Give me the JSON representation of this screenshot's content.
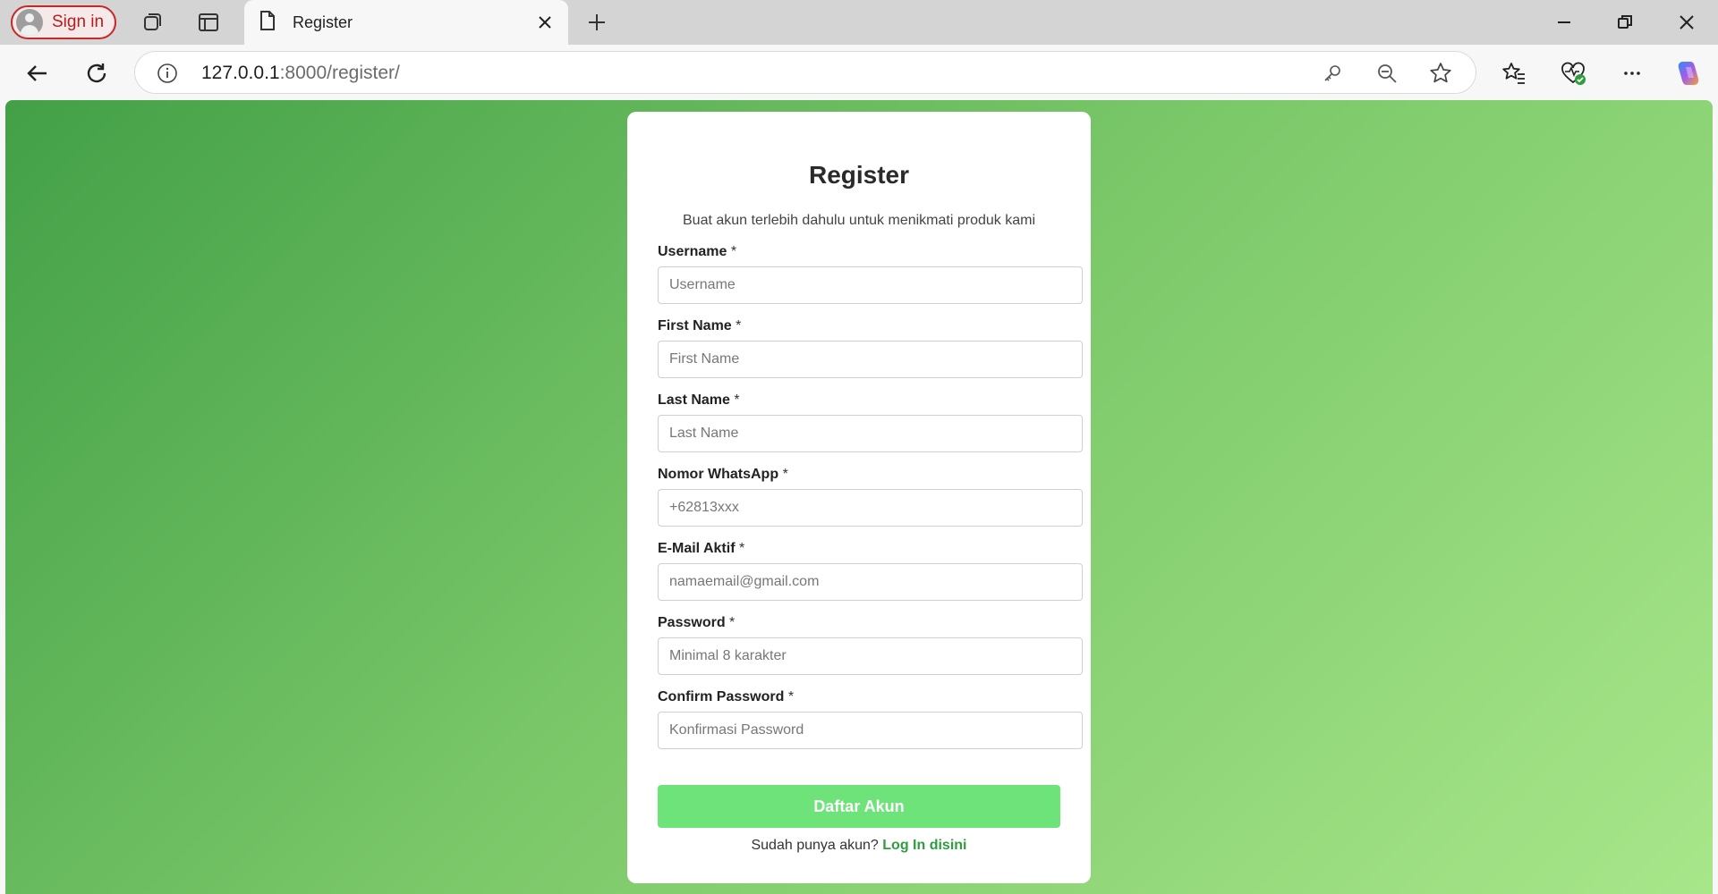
{
  "browser": {
    "signin_label": "Sign in",
    "tab_title": "Register",
    "url_host": "127.0.0.1",
    "url_path": ":8000/register/"
  },
  "icons": [
    "profile-avatar-icon",
    "workspaces-icon",
    "tab-actions-icon",
    "page-icon",
    "close-icon",
    "plus-icon",
    "minimize-icon",
    "restore-icon",
    "window-close-icon",
    "back-icon",
    "refresh-icon",
    "info-icon",
    "key-icon",
    "zoom-out-icon",
    "star-icon",
    "favorites-icon",
    "health-icon",
    "more-icon",
    "copilot-icon"
  ],
  "form": {
    "title": "Register",
    "subtitle": "Buat akun terlebih dahulu untuk menikmati produk kami",
    "required_mark": "*",
    "fields": [
      {
        "label": "Username",
        "placeholder": "Username",
        "value": ""
      },
      {
        "label": "First Name",
        "placeholder": "First Name",
        "value": ""
      },
      {
        "label": "Last Name",
        "placeholder": "Last Name",
        "value": ""
      },
      {
        "label": "Nomor WhatsApp",
        "placeholder": "+62813xxx",
        "value": ""
      },
      {
        "label": "E-Mail Aktif",
        "placeholder": "namaemail@gmail.com",
        "value": ""
      },
      {
        "label": "Password",
        "placeholder": "Minimal 8 karakter",
        "value": ""
      },
      {
        "label": "Confirm Password",
        "placeholder": "Konfirmasi Password",
        "value": ""
      }
    ],
    "submit_label": "Daftar Akun",
    "footer_text": "Sudah punya akun?",
    "login_link": "Log In disini"
  },
  "colors": {
    "gradient_start": "#43a047",
    "gradient_end": "#a8e68a",
    "button": "#6ee37a",
    "link": "#2e9e3e"
  }
}
